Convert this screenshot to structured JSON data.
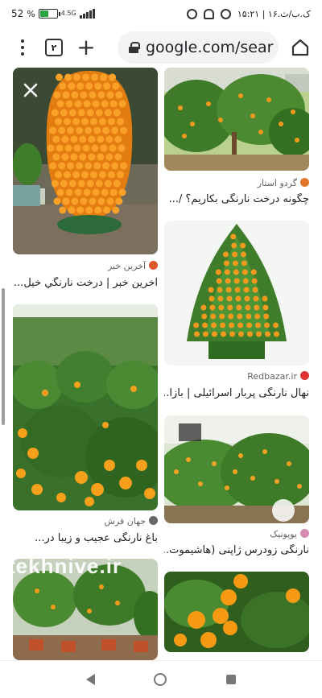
{
  "status_bar": {
    "battery": "52",
    "battery_level": 0.52,
    "network": "4.5G",
    "time": "۱۵:۲۱ | ۱۶.ک.ب/ث"
  },
  "toolbar": {
    "tab_count": "۲",
    "plus": "+",
    "url": "google.com/sear"
  },
  "results": {
    "left": [
      {
        "source": "آخرین خبر",
        "title": "آخرین خبر | درخت نارنگي خيل..."
      },
      {
        "source": "جهان فرش",
        "title": "باغ نارنگی عجیب و زیبا در..."
      },
      {
        "source": "",
        "title": ""
      }
    ],
    "right": [
      {
        "source": "گردو استار",
        "title": "چگونه درخت نارنگی بکاریم؟ /..."
      },
      {
        "source": "Redbazar.ir",
        "title": "نهال نارنگی پربار اسرائیلی | بازا..."
      },
      {
        "source": "یوپونیک",
        "title": "نارنگی زودرس ژاپنی (هاشیموت..."
      },
      {
        "source": "",
        "title": ""
      }
    ]
  },
  "watermark": "tekhnive.ir",
  "colors": {
    "url_bar_bg": "#f1f3f4",
    "fruit": "#f39a1e",
    "leaf": "#3f7d2b",
    "battery_fill": "#2aa640"
  },
  "icons": [
    "menu-icon",
    "tabs-icon",
    "plus-icon",
    "lock-icon",
    "home-icon",
    "close-icon",
    "back-icon",
    "home-circle-icon",
    "recents-icon"
  ]
}
